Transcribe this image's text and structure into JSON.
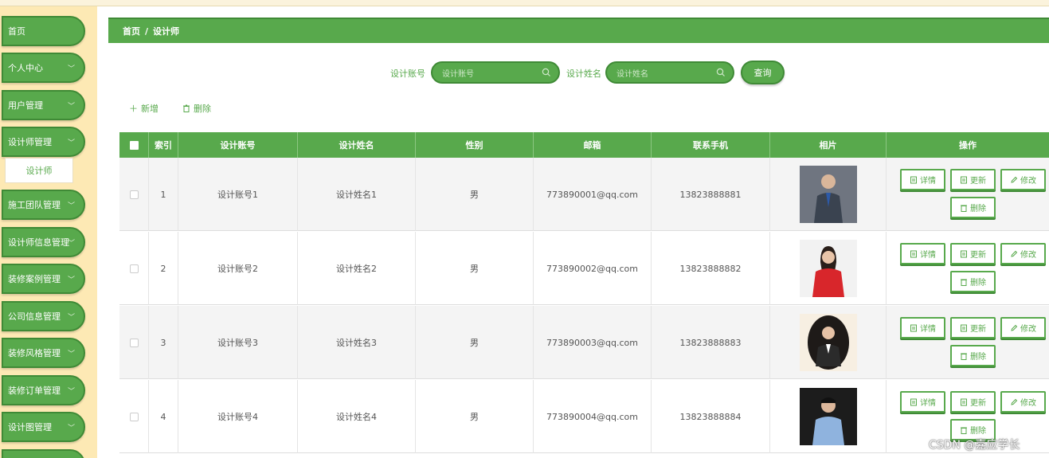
{
  "sidebar": {
    "items": [
      {
        "label": "首页",
        "expandable": false
      },
      {
        "label": "个人中心",
        "expandable": true
      },
      {
        "label": "用户管理",
        "expandable": true
      },
      {
        "label": "设计师管理",
        "expandable": true
      },
      {
        "label": "施工团队管理",
        "expandable": true
      },
      {
        "label": "设计师信息管理",
        "expandable": true
      },
      {
        "label": "装修案例管理",
        "expandable": true
      },
      {
        "label": "公司信息管理",
        "expandable": true
      },
      {
        "label": "装修风格管理",
        "expandable": true
      },
      {
        "label": "装修订单管理",
        "expandable": true
      },
      {
        "label": "设计图管理",
        "expandable": true
      }
    ],
    "active_submenu": "设计师"
  },
  "breadcrumb": {
    "home": "首页",
    "separator": "/",
    "current": "设计师"
  },
  "search": {
    "account_label": "设计账号",
    "account_placeholder": "设计账号",
    "name_label": "设计姓名",
    "name_placeholder": "设计姓名",
    "query_label": "查询"
  },
  "actions": {
    "add_label": "新增",
    "delete_label": "删除"
  },
  "table": {
    "headers": [
      "",
      "索引",
      "设计账号",
      "设计姓名",
      "性别",
      "邮箱",
      "联系手机",
      "相片",
      "操作"
    ],
    "rows": [
      {
        "index": "1",
        "account": "设计账号1",
        "name": "设计姓名1",
        "gender": "男",
        "email": "773890001@qq.com",
        "phone": "13823888881"
      },
      {
        "index": "2",
        "account": "设计账号2",
        "name": "设计姓名2",
        "gender": "男",
        "email": "773890002@qq.com",
        "phone": "13823888882"
      },
      {
        "index": "3",
        "account": "设计账号3",
        "name": "设计姓名3",
        "gender": "男",
        "email": "773890003@qq.com",
        "phone": "13823888883"
      },
      {
        "index": "4",
        "account": "设计账号4",
        "name": "设计姓名4",
        "gender": "男",
        "email": "773890004@qq.com",
        "phone": "13823888884"
      }
    ],
    "row_buttons": {
      "detail": "详情",
      "update": "更新",
      "modify": "修改",
      "delete": "删除"
    }
  },
  "watermark": "CSDN @嘉应学长",
  "colors": {
    "primary": "#58a94c",
    "primary_dark": "#3f8a36",
    "sidebar_bg": "#fde9b4"
  }
}
